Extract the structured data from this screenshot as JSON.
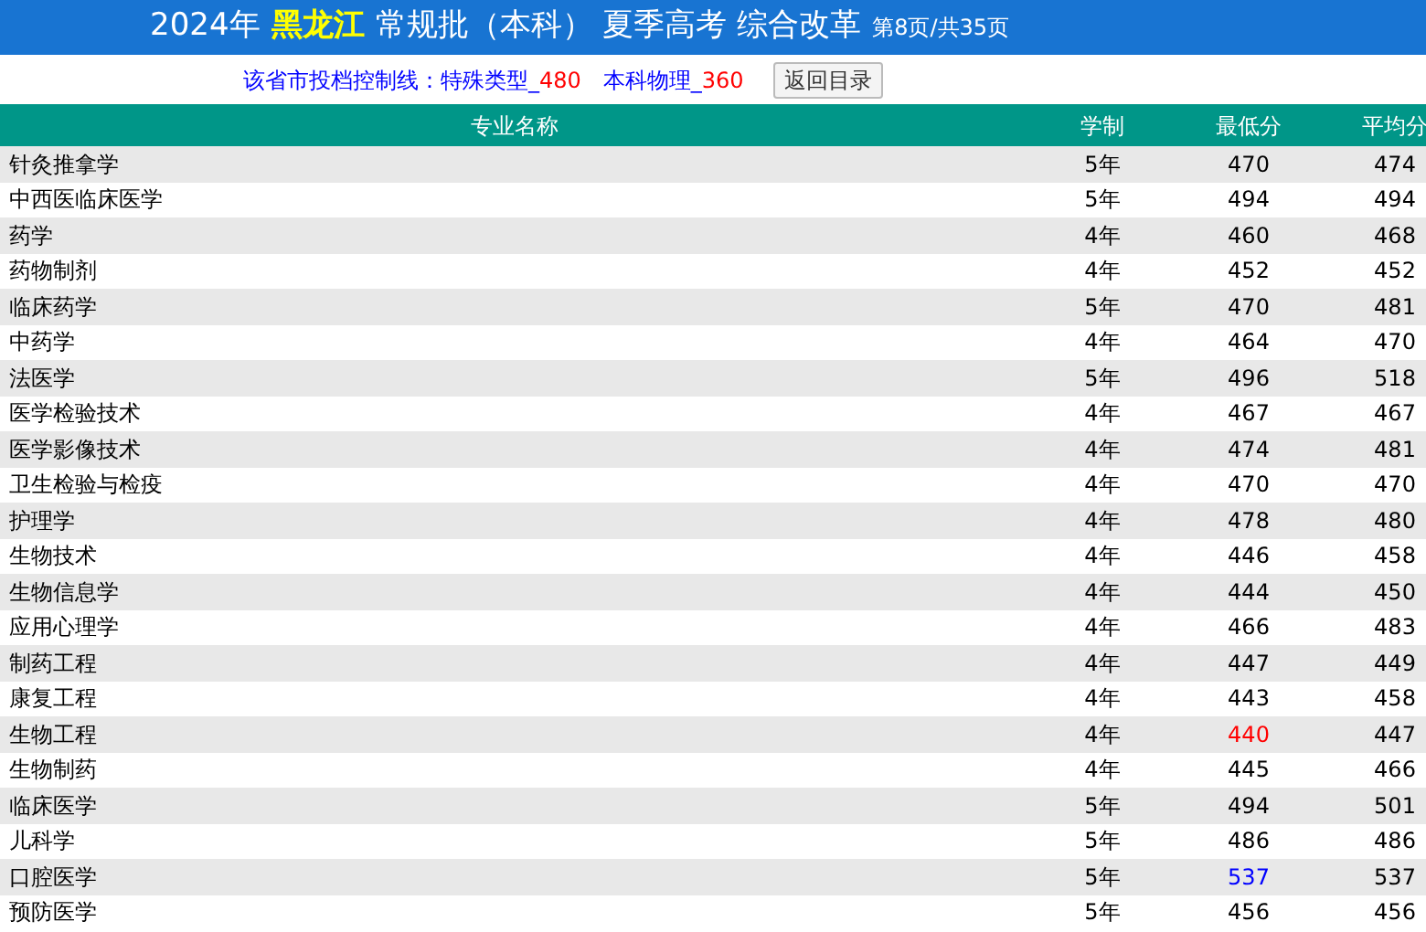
{
  "title": {
    "year": "2024年",
    "province": "黑龙江",
    "rest": "常规批（本科） 夏季高考 综合改革",
    "page": "第8页/共35页"
  },
  "control_lines": {
    "label": "该省市投档控制线：",
    "items": [
      {
        "name": "特殊类型_",
        "value": "480"
      },
      {
        "name": "本科物理_",
        "value": "360"
      }
    ]
  },
  "back_button": "返回目录",
  "table": {
    "columns": [
      "专业名称",
      "学制",
      "最低分",
      "平均分"
    ],
    "rows": [
      {
        "name": "针灸推拿学",
        "years": "5年",
        "min": {
          "text": "470",
          "color": "#000000"
        },
        "avg": "474"
      },
      {
        "name": "中西医临床医学",
        "years": "5年",
        "min": {
          "text": "494",
          "color": "#000000"
        },
        "avg": "494"
      },
      {
        "name": "药学",
        "years": "4年",
        "min": {
          "text": "460",
          "color": "#000000"
        },
        "avg": "468"
      },
      {
        "name": "药物制剂",
        "years": "4年",
        "min": {
          "text": "452",
          "color": "#000000"
        },
        "avg": "452"
      },
      {
        "name": "临床药学",
        "years": "5年",
        "min": {
          "text": "470",
          "color": "#000000"
        },
        "avg": "481"
      },
      {
        "name": "中药学",
        "years": "4年",
        "min": {
          "text": "464",
          "color": "#000000"
        },
        "avg": "470"
      },
      {
        "name": "法医学",
        "years": "5年",
        "min": {
          "text": "496",
          "color": "#000000"
        },
        "avg": "518"
      },
      {
        "name": "医学检验技术",
        "years": "4年",
        "min": {
          "text": "467",
          "color": "#000000"
        },
        "avg": "467"
      },
      {
        "name": "医学影像技术",
        "years": "4年",
        "min": {
          "text": "474",
          "color": "#000000"
        },
        "avg": "481"
      },
      {
        "name": "卫生检验与检疫",
        "years": "4年",
        "min": {
          "text": "470",
          "color": "#000000"
        },
        "avg": "470"
      },
      {
        "name": "护理学",
        "years": "4年",
        "min": {
          "text": "478",
          "color": "#000000"
        },
        "avg": "480"
      },
      {
        "name": "生物技术",
        "years": "4年",
        "min": {
          "text": "446",
          "color": "#000000"
        },
        "avg": "458"
      },
      {
        "name": "生物信息学",
        "years": "4年",
        "min": {
          "text": "444",
          "color": "#000000"
        },
        "avg": "450"
      },
      {
        "name": "应用心理学",
        "years": "4年",
        "min": {
          "text": "466",
          "color": "#000000"
        },
        "avg": "483"
      },
      {
        "name": "制药工程",
        "years": "4年",
        "min": {
          "text": "447",
          "color": "#000000"
        },
        "avg": "449"
      },
      {
        "name": "康复工程",
        "years": "4年",
        "min": {
          "text": "443",
          "color": "#000000"
        },
        "avg": "458"
      },
      {
        "name": "生物工程",
        "years": "4年",
        "min": {
          "text": "440",
          "color": "#ff0000"
        },
        "avg": "447"
      },
      {
        "name": "生物制药",
        "years": "4年",
        "min": {
          "text": "445",
          "color": "#000000"
        },
        "avg": "466"
      },
      {
        "name": "临床医学",
        "years": "5年",
        "min": {
          "text": "494",
          "color": "#000000"
        },
        "avg": "501"
      },
      {
        "name": "儿科学",
        "years": "5年",
        "min": {
          "text": "486",
          "color": "#000000"
        },
        "avg": "486"
      },
      {
        "name": "口腔医学",
        "years": "5年",
        "min": {
          "text": "537",
          "color": "#0000ff"
        },
        "avg": "537"
      },
      {
        "name": "预防医学",
        "years": "5年",
        "min": {
          "text": "456",
          "color": "#000000"
        },
        "avg": "456"
      }
    ]
  }
}
